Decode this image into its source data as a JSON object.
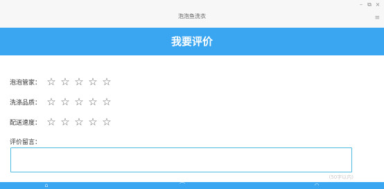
{
  "window": {
    "title": "泡泡鱼洗衣",
    "minimize_label": "–",
    "restore_label": "⧉",
    "close_label": "×",
    "menu_label": "≡"
  },
  "header": {
    "title": "我要评价"
  },
  "ratings": [
    {
      "label": "泡泡管家：",
      "value": 0,
      "max": 5
    },
    {
      "label": "洗涤品质：",
      "value": 0,
      "max": 5
    },
    {
      "label": "配送速度：",
      "value": 0,
      "max": 5
    }
  ],
  "star_glyph": "☆",
  "comment": {
    "label": "评价留言：",
    "value": "",
    "placeholder": "",
    "limit_text": "(50字以内)"
  },
  "colors": {
    "accent": "#3aa6f2",
    "input_border": "#4dbbe0"
  }
}
